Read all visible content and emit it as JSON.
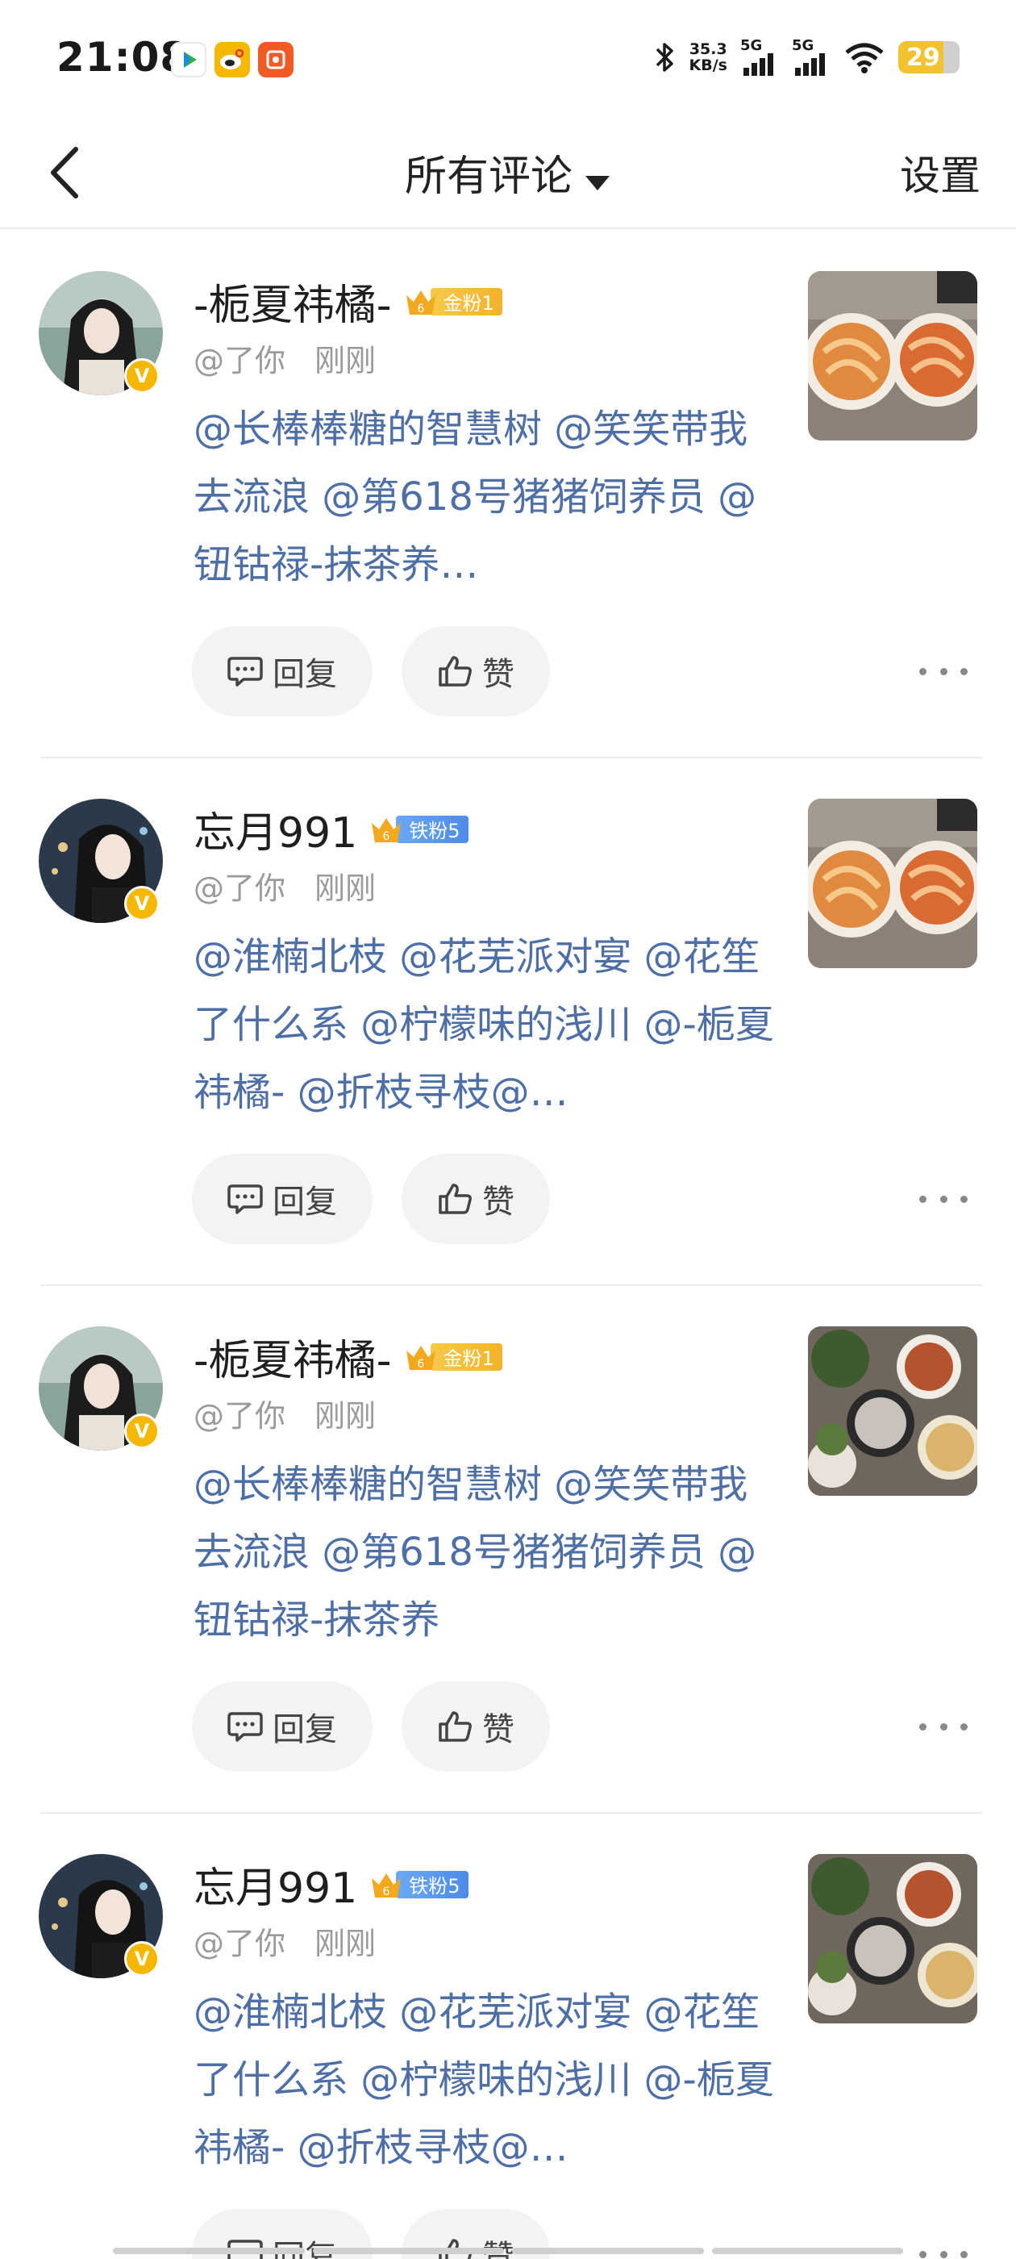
{
  "status_bar": {
    "time": "21:08",
    "net_speed_value": "35.3",
    "net_speed_unit": "KB/s",
    "signal_1_label": "5G",
    "signal_2_label": "5G",
    "battery": "29"
  },
  "nav": {
    "title": "所有评论",
    "settings": "设置"
  },
  "comments": [
    {
      "username": "-栀夏祎橘-",
      "badge_level": "6",
      "badge_label": "金粉1",
      "badge_color": "#f5b830",
      "handle": "@了你",
      "time": "刚刚",
      "text": "@长棒棒糖的智慧树 @笑笑带我去流浪 @第618号猪猪饲养员 @钮钴禄-抹茶养…",
      "reply": "回复",
      "like": "赞"
    },
    {
      "username": "忘月991",
      "badge_level": "6",
      "badge_label": "铁粉5",
      "badge_color": "#5a97ec",
      "handle": "@了你",
      "time": "刚刚",
      "text": "@淮楠北枝 @花芜派对宴 @花笙了什么系 @柠檬味的浅川 @-栀夏祎橘- @折枝寻枝@…",
      "reply": "回复",
      "like": "赞"
    },
    {
      "username": "-栀夏祎橘-",
      "badge_level": "6",
      "badge_label": "金粉1",
      "badge_color": "#f5b830",
      "handle": "@了你",
      "time": "刚刚",
      "text": "@长棒棒糖的智慧树 @笑笑带我去流浪 @第618号猪猪饲养员 @钮钴禄-抹茶养",
      "reply": "回复",
      "like": "赞"
    },
    {
      "username": "忘月991",
      "badge_level": "6",
      "badge_label": "铁粉5",
      "badge_color": "#5a97ec",
      "handle": "@了你",
      "time": "刚刚",
      "text": "@淮楠北枝 @花芜派对宴 @花笙了什么系 @柠檬味的浅川 @-栀夏祎橘- @折枝寻枝@…",
      "reply": "回复",
      "like": "赞"
    }
  ],
  "icons": {
    "back": "back-arrow-icon",
    "caret": "caret-down-icon",
    "reply": "comment-bubble-icon",
    "like": "thumbs-up-icon",
    "more": "more-dots-icon",
    "verified": "verified-v-icon"
  },
  "colors": {
    "mention_link": "#4e6fa6",
    "verified_badge": "#f5b700"
  }
}
